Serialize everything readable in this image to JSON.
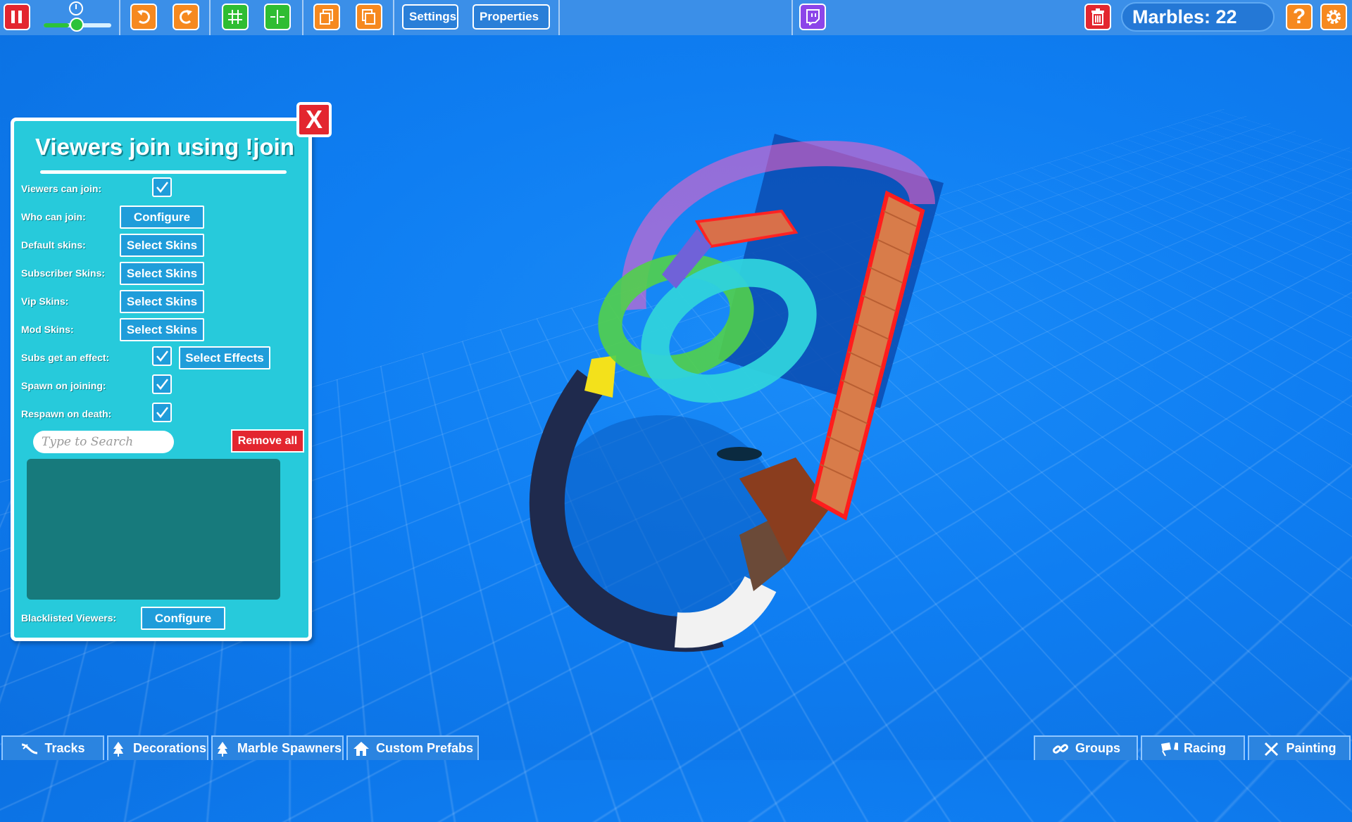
{
  "toolbar": {
    "settings_label": "Settings",
    "properties_label": "Properties",
    "marbles_label": "Marbles: 22",
    "help_label": "?",
    "speed_slider_value": 0.38
  },
  "panel": {
    "title": "Viewers join using !join",
    "close_label": "X",
    "rows": [
      {
        "label": "Viewers can join:",
        "checked": true
      },
      {
        "label": "Who can join:",
        "button": "Configure"
      },
      {
        "label": "Default skins:",
        "button": "Select Skins"
      },
      {
        "label": "Subscriber Skins:",
        "button": "Select Skins"
      },
      {
        "label": "Vip Skins:",
        "button": "Select Skins"
      },
      {
        "label": "Mod Skins:",
        "button": "Select Skins"
      },
      {
        "label": "Subs get an effect:",
        "checked": true,
        "button": "Select Effects"
      },
      {
        "label": "Spawn on joining:",
        "checked": true
      },
      {
        "label": "Respawn on death:",
        "checked": true
      }
    ],
    "search_placeholder": "Type to Search",
    "remove_all_label": "Remove all",
    "blacklisted_label": "Blacklisted Viewers:",
    "blacklisted_button": "Configure"
  },
  "bottom_tabs": [
    {
      "label": "Tracks",
      "icon": "tracks-icon"
    },
    {
      "label": "Decorations",
      "icon": "tree-icon"
    },
    {
      "label": "Marble Spawners",
      "icon": "tree-icon"
    },
    {
      "label": "Custom Prefabs",
      "icon": "house-icon"
    },
    {
      "label": "Groups",
      "icon": "link-icon"
    },
    {
      "label": "Racing",
      "icon": "flags-icon"
    },
    {
      "label": "Painting",
      "icon": "brush-icon"
    }
  ]
}
